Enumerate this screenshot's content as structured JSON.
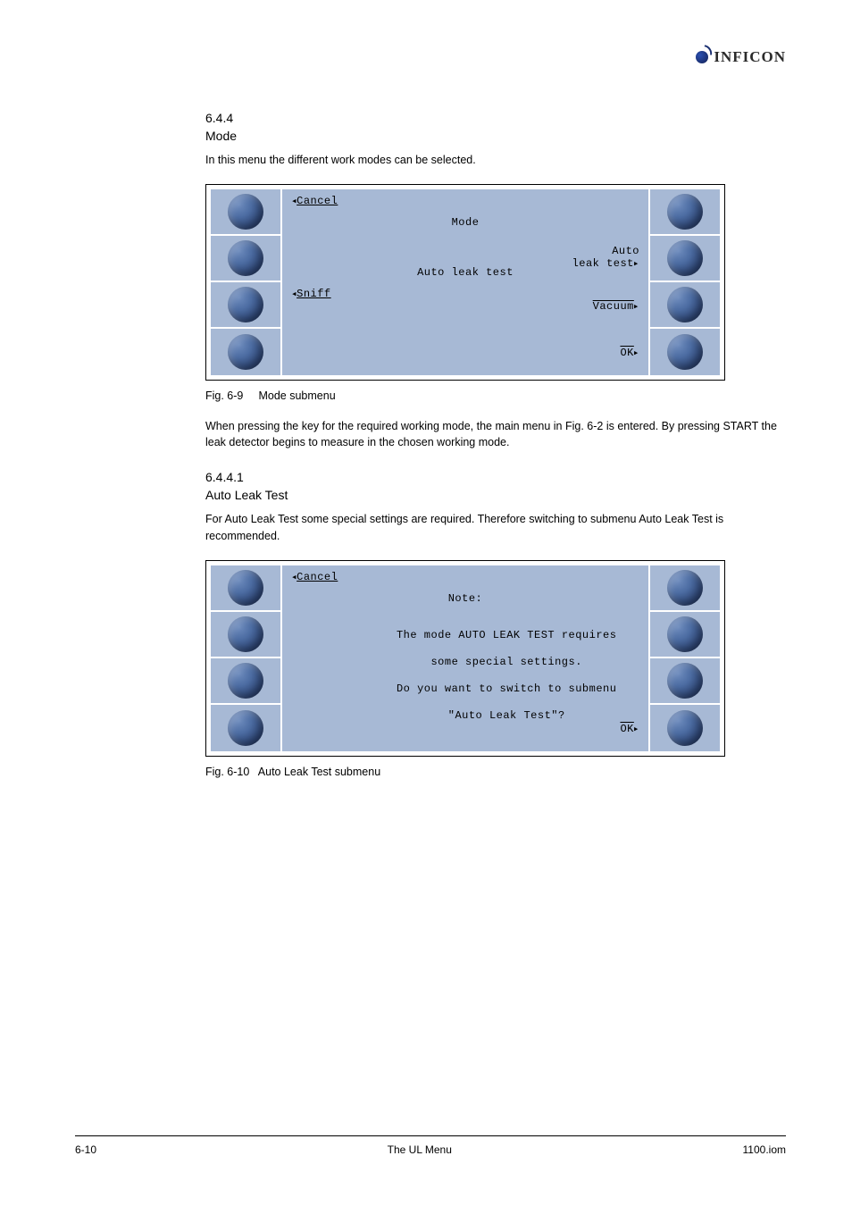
{
  "brand": {
    "name": "INFICON"
  },
  "section": {
    "number": "6.4.4",
    "title": "Mode",
    "intro": "In this menu the different work modes can be selected.",
    "paragraph": "When pressing the key for the required working mode, the main menu in Fig. 6-2 is entered. By pressing START the leak detector begins to measure in the chosen working mode."
  },
  "lcd1": {
    "left": {
      "cancel": "Cancel",
      "sniff": "Sniff"
    },
    "right": {
      "auto_line1": "Auto",
      "auto_line2": "leak test",
      "vacuum": "Vacuum",
      "ok": "OK"
    },
    "title": "Mode",
    "current": "Auto leak test"
  },
  "fig1": {
    "label": "Fig. 6-9",
    "caption": "Mode submenu"
  },
  "subsection": {
    "number": "6.4.4.1",
    "title": "Auto Leak Test",
    "paragraph": "For Auto Leak Test some special settings are required. Therefore switching to submenu Auto Leak Test is recommended."
  },
  "lcd2": {
    "left": {
      "cancel": "Cancel"
    },
    "right": {
      "ok": "OK"
    },
    "title": "Note:",
    "body_line1": "The mode AUTO LEAK TEST requires",
    "body_line2": "some special settings.",
    "body_line3": "Do you want to switch to submenu",
    "body_line4": "\"Auto Leak Test\"?"
  },
  "fig2": {
    "label": "Fig. 6-10",
    "caption": "Auto Leak Test submenu"
  },
  "footer": {
    "left": "6-10",
    "center": "The UL Menu",
    "right": "1100.iom"
  }
}
